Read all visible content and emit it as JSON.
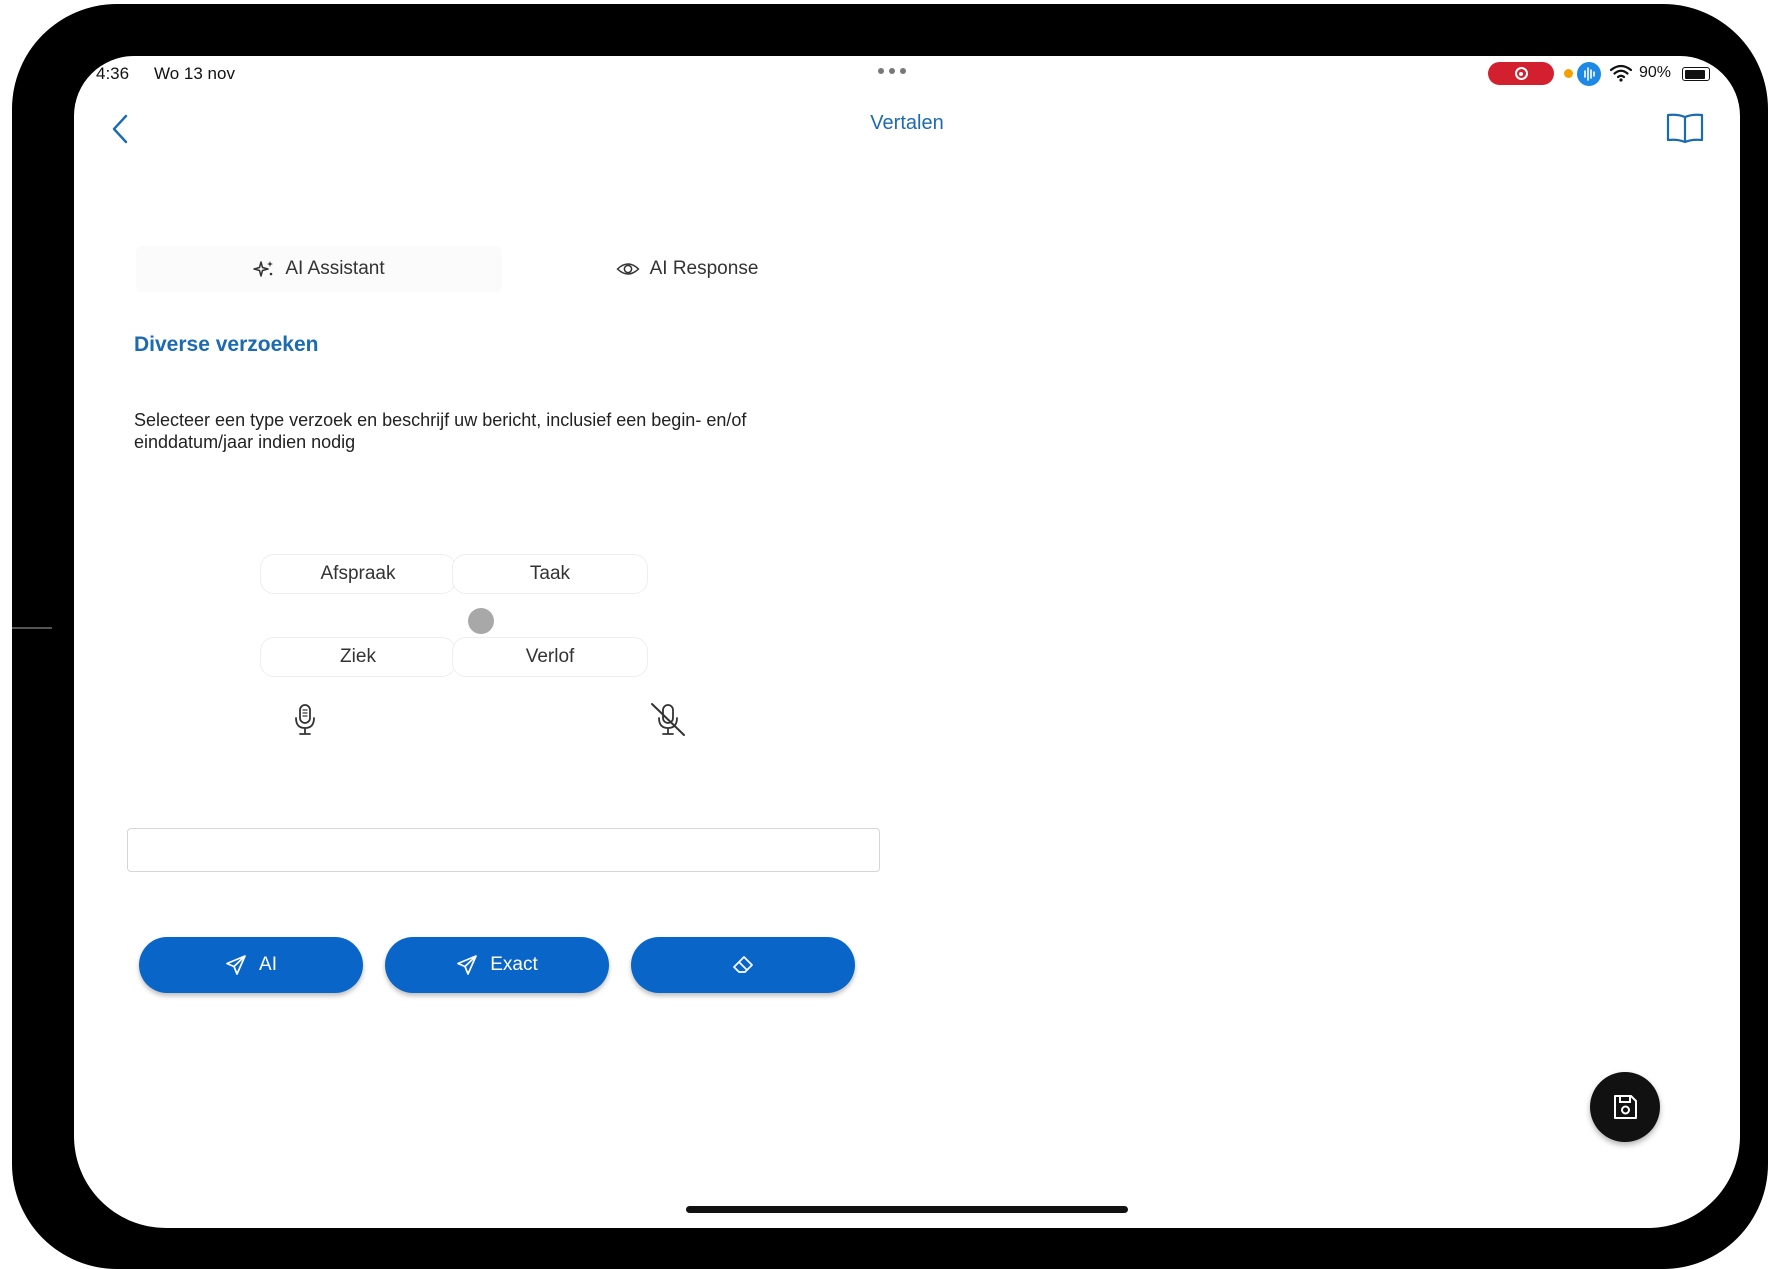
{
  "status_bar": {
    "time": "4:36",
    "date": "Wo 13 nov",
    "battery": "90%",
    "icons": [
      "screen-record-icon",
      "microphone-active-icon",
      "wifi-icon",
      "battery-icon"
    ]
  },
  "nav": {
    "title": "Vertalen",
    "back_icon": "chevron-left-icon",
    "right_icon": "book-icon"
  },
  "tabs": [
    {
      "label": "AI Assistant",
      "icon": "sparkles-icon",
      "selected": true
    },
    {
      "label": "AI Response",
      "icon": "eye-icon",
      "selected": false
    }
  ],
  "section": {
    "title": "Diverse verzoeken",
    "instructions_line1": "Selecteer een type verzoek en beschrijf uw bericht, inclusief een begin- en/of",
    "instructions_line2": "einddatum/jaar indien nodig"
  },
  "request_types": [
    "Afspraak",
    "Taak",
    "Ziek",
    "Verlof"
  ],
  "voice": {
    "start_icon": "microphone-icon",
    "stop_icon": "microphone-off-icon"
  },
  "message_input": {
    "value": "",
    "placeholder": ""
  },
  "actions": [
    {
      "label": "AI",
      "icon": "send-icon"
    },
    {
      "label": "Exact",
      "icon": "send-icon"
    },
    {
      "label": "",
      "icon": "eraser-icon"
    }
  ],
  "fab": {
    "icon": "save-icon"
  },
  "colors": {
    "accent": "#1c6bb0",
    "button": "#0a65c8",
    "fab": "#111111",
    "record": "#d2202f"
  }
}
